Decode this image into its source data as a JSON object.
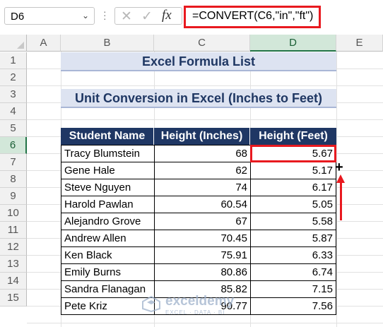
{
  "formula_bar": {
    "name_box": "D6",
    "name_box_arrow": "⌄",
    "cancel_symbol": "✕",
    "enter_symbol": "✓",
    "fx_label": "fx",
    "formula": "=CONVERT(C6,\"in\",\"ft\")"
  },
  "columns": [
    "A",
    "B",
    "C",
    "D",
    "E"
  ],
  "rows": [
    "1",
    "2",
    "3",
    "4",
    "5",
    "6",
    "7",
    "8",
    "9",
    "10",
    "11",
    "12",
    "13",
    "14",
    "15"
  ],
  "sheet": {
    "title": "Excel Formula List",
    "subtitle": "Unit Conversion in Excel (Inches to Feet)",
    "headers": [
      "Student Name",
      "Height (Inches)",
      "Height (Feet)"
    ],
    "data": [
      {
        "name": "Tracy Blumstein",
        "inches": "68",
        "feet": "5.67"
      },
      {
        "name": "Gene Hale",
        "inches": "62",
        "feet": "5.17"
      },
      {
        "name": "Steve Nguyen",
        "inches": "74",
        "feet": "6.17"
      },
      {
        "name": "Harold Pawlan",
        "inches": "60.54",
        "feet": "5.05"
      },
      {
        "name": "Alejandro Grove",
        "inches": "67",
        "feet": "5.58"
      },
      {
        "name": "Andrew Allen",
        "inches": "70.45",
        "feet": "5.87"
      },
      {
        "name": "Ken Black",
        "inches": "75.91",
        "feet": "6.33"
      },
      {
        "name": "Emily Burns",
        "inches": "80.86",
        "feet": "6.74"
      },
      {
        "name": "Sandra Flanagan",
        "inches": "85.82",
        "feet": "7.15"
      },
      {
        "name": "Pete Kriz",
        "inches": "90.77",
        "feet": "7.56"
      }
    ]
  },
  "selected_cell": "D6",
  "watermark": {
    "name": "exceldemy",
    "tagline": "EXCEL · DATA · BI"
  },
  "colors": {
    "header_fill": "#1f3764",
    "title_fill": "#dde3f1",
    "highlight": "#e8191f",
    "selection_green": "#217346"
  }
}
